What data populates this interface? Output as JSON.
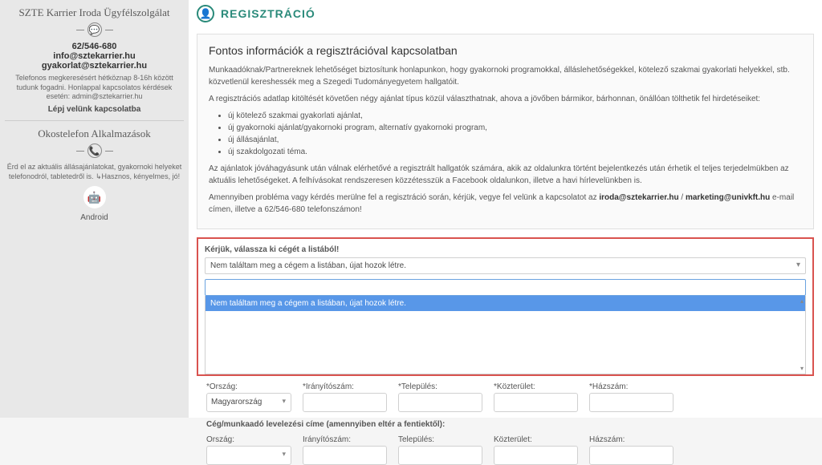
{
  "sidebar": {
    "title": "SZTE Karrier Iroda Ügyfélszolgálat",
    "phone": "62/546-680",
    "email1": "info@sztekarrier.hu",
    "email2": "gyakorlat@sztekarrier.hu",
    "desc1": "Telefonos megkeresésért hétköznap 8-16h között tudunk fogadni. Honlappal kapcsolatos kérdések esetén: admin@sztekarrier.hu",
    "link1": "Lépj velünk kapcsolatba",
    "apps_title": "Okostelefon Alkalmazások",
    "desc2": "Érd el az aktuális állásajánlatokat, gyakornoki helyeket telefonodról, tabletedről is. ↳Hasznos, kényelmes, jó!",
    "android": "Android"
  },
  "page": {
    "title": "REGISZTRÁCIÓ"
  },
  "info": {
    "title": "Fontos információk a regisztrációval kapcsolatban",
    "p1": "Munkaadóknak/Partnereknek lehetőséget biztosítunk honlapunkon, hogy gyakornoki programokkal, álláslehetőségekkel, kötelező szakmai gyakorlati helyekkel, stb. közvetlenül kereshessék meg a Szegedi Tudományegyetem hallgatóit.",
    "p2": "A regisztrációs adatlap kitöltését követően négy ajánlat típus közül választhatnak, ahova a jövőben bármikor, bárhonnan, önállóan tölthetik fel hirdetéseiket:",
    "li1": "új kötelező szakmai gyakorlati ajánlat,",
    "li2": "új gyakornoki ajánlat/gyakornoki program, alternatív gyakornoki program,",
    "li3": "új állásajánlat,",
    "li4": "új szakdolgozati téma.",
    "p3": "Az ajánlatok jóváhagyásunk után válnak elérhetővé a regisztrált hallgatók számára, akik az oldalunkra történt bejelentkezés után érhetik el teljes terjedelmükben az aktuális lehetőségeket. A felhívásokat rendszeresen közzétesszük a Facebook oldalunkon, illetve a havi hírlevelünkben is.",
    "p4a": "Amennyiben probléma vagy kérdés merülne fel a regisztráció során, kérjük, vegye fel velünk a kapcsolatot az ",
    "em1": "iroda@sztekarrier.hu",
    "sep": " / ",
    "em2": "marketing@univkft.hu",
    "p4b": " e-mail címen, illetve a 62/546-680 telefonszámon!"
  },
  "select": {
    "label": "Kérjük, válassza ki cégét a listából!",
    "selected": "Nem találtam meg a cégem a listában, újat hozok létre.",
    "option1": "Nem találtam meg a cégem a listában, újat hozok létre."
  },
  "form": {
    "country_label": "Ország:",
    "country_value": "Magyarország",
    "zip_label": "Irányítószám:",
    "city_label": "Település:",
    "street_label": "Közterület:",
    "number_label": "Házszám:",
    "mail_section": "Cég/munkaadó levelezési címe (amennyiben eltér a fentiektől):"
  }
}
